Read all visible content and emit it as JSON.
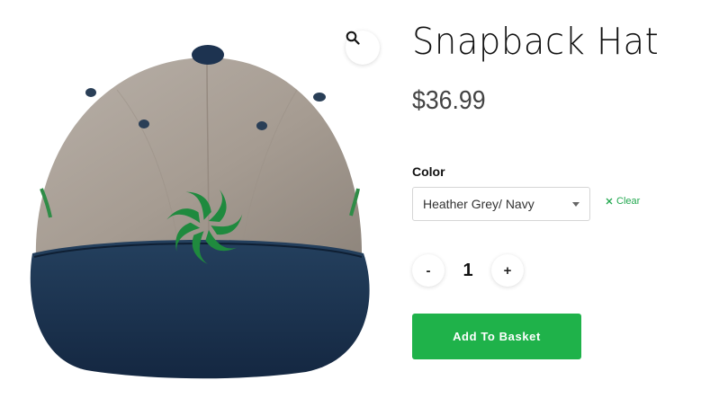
{
  "product": {
    "image_alt": "Heather Grey / Navy snapback hat with green embroidered swirl logo",
    "title": "Snapback Hat",
    "price": "$36.99"
  },
  "variation": {
    "label": "Color",
    "selected": "Heather Grey/ Navy",
    "clear_label": "Clear"
  },
  "quantity": {
    "minus_label": "-",
    "value": "1",
    "plus_label": "+"
  },
  "actions": {
    "add_to_basket": "Add To Basket"
  },
  "icons": {
    "zoom": "search-icon",
    "clear": "close-icon",
    "select": "dropdown-arrow-icon"
  },
  "colors": {
    "accent": "#1fb24a",
    "crown": "#a79d94",
    "brim": "#1c3450",
    "logo": "#1f8a3e"
  }
}
